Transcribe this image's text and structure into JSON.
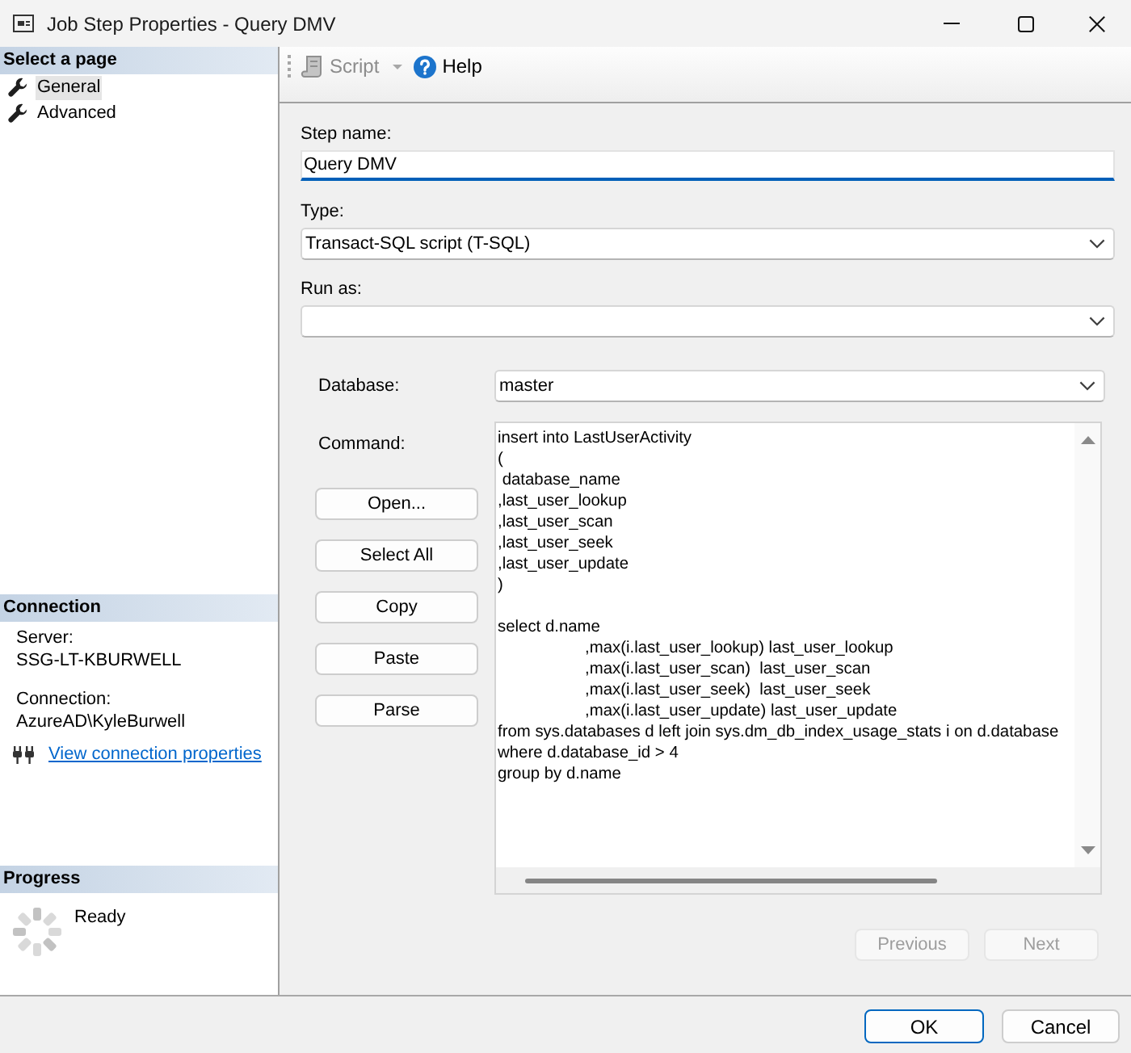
{
  "window": {
    "title": "Job Step Properties - Query DMV"
  },
  "sidebar": {
    "header": "Select a page",
    "items": [
      {
        "label": "General",
        "selected": true
      },
      {
        "label": "Advanced",
        "selected": false
      }
    ],
    "connection": {
      "header": "Connection",
      "fields": [
        {
          "label": "Server:",
          "value": "SSG-LT-KBURWELL"
        },
        {
          "label": "Connection:",
          "value": "AzureAD\\KyleBurwell"
        }
      ],
      "link": "View connection properties"
    },
    "progress": {
      "header": "Progress",
      "status": "Ready"
    }
  },
  "toolbar": [
    {
      "kind": "script",
      "label": "Script",
      "disabled": true,
      "dropdown": true
    },
    {
      "kind": "help",
      "label": "Help",
      "disabled": false,
      "dropdown": false
    }
  ],
  "form": {
    "step_name": {
      "label": "Step name:",
      "value": "Query DMV",
      "focused": true
    },
    "type": {
      "label": "Type:",
      "value": "Transact-SQL script (T-SQL)"
    },
    "run_as": {
      "label": "Run as:"
    },
    "database": {
      "label": "Database:",
      "value": "master"
    },
    "command": {
      "label": "Command:",
      "text": "insert into LastUserActivity\n(\n database_name\n,last_user_lookup\n,last_user_scan\n,last_user_seek\n,last_user_update\n)\n\nselect d.name\n\t\t,max(i.last_user_lookup) last_user_lookup\n\t\t,max(i.last_user_scan)  last_user_scan\n\t\t,max(i.last_user_seek)  last_user_seek\n\t\t,max(i.last_user_update) last_user_update\nfrom sys.databases d left join sys.dm_db_index_usage_stats i on d.database\nwhere d.database_id > 4\ngroup by d.name"
    },
    "command_buttons": [
      "Open...",
      "Select All",
      "Copy",
      "Paste",
      "Parse"
    ],
    "nav_buttons": [
      {
        "label": "Previous",
        "disabled": true
      },
      {
        "label": "Next",
        "disabled": true
      }
    ]
  },
  "buttons": [
    {
      "label": "OK",
      "default": true
    },
    {
      "label": "Cancel",
      "default": false
    }
  ]
}
